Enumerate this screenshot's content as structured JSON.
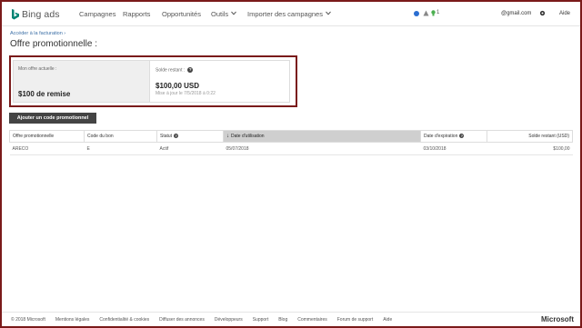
{
  "header": {
    "logo_text": "Bing ads",
    "nav": [
      "Campagnes",
      "Rapports",
      "Opportunités",
      "Outils",
      "Importer des campagnes"
    ],
    "notification_count": "1",
    "email": "@gmail.com",
    "help": "Aide",
    "colors": {
      "info": "#2b6ed1",
      "alert": "#888888",
      "lightbulb": "#4caf50",
      "bing": "#008373"
    }
  },
  "breadcrumb": "Accéder à la facturation ›",
  "page_title": "Offre promotionnelle :",
  "summary": {
    "offer_label": "Mon offre actuelle :",
    "offer_value": "$100 de remise",
    "balance_label": "Solde restant :",
    "balance_value": "$100,00 USD",
    "balance_updated": "Mise à jour le 7/5/2018 à 0:22"
  },
  "add_button": "Ajouter un code promotionnel",
  "table": {
    "headers": [
      "Offre promotionnelle",
      "Code du bon",
      "Statut",
      "Date d'utilisation",
      "Date d'expiration",
      "Solde restant (USD)"
    ],
    "rows": [
      [
        "ARECO",
        "E",
        "Actif",
        "05/07/2018",
        "03/10/2018",
        "$100,00"
      ]
    ]
  },
  "footer": {
    "links": [
      "© 2018 Microsoft",
      "Mentions légales",
      "Confidentialité & cookies",
      "Diffuser des annonces",
      "Développeurs",
      "Support",
      "Blog",
      "Commentaires",
      "Forum de support",
      "Aide"
    ],
    "brand": "Microsoft"
  }
}
